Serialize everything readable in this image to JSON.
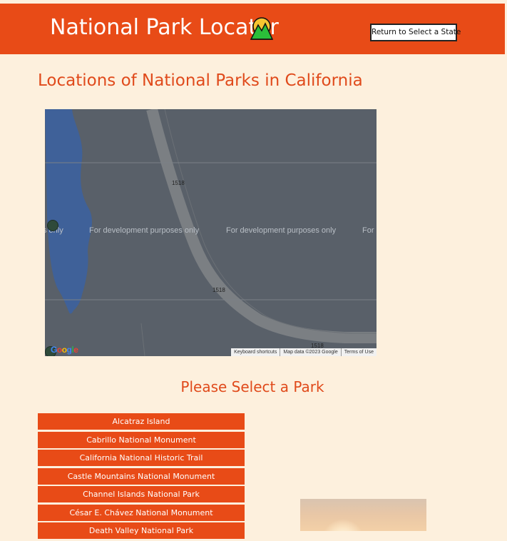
{
  "header": {
    "title": "National Park Locator",
    "return_label": "Return to Select a State",
    "colors": {
      "brand": "#e84b17",
      "background": "#fdf0dd"
    }
  },
  "page": {
    "title": "Locations of National Parks in California"
  },
  "map": {
    "road_labels": [
      "1518",
      "1518",
      "1518"
    ],
    "watermark": "For development purposes only",
    "watermark_fragments": [
      "s only",
      "For development purposes only",
      "For development purposes only",
      "For"
    ],
    "footer": [
      "Keyboard shortcuts",
      "Map data ©2023 Google",
      "Terms of Use"
    ],
    "logo_letters": [
      "G",
      "o",
      "o",
      "g",
      "l",
      "e"
    ]
  },
  "parks": {
    "heading": "Please Select a Park",
    "items": [
      "Alcatraz Island",
      "Cabrillo National Monument",
      "California National Historic Trail",
      "Castle Mountains National Monument",
      "Channel Islands National Park",
      "César E. Chávez National Monument",
      "Death Valley National Park"
    ]
  }
}
